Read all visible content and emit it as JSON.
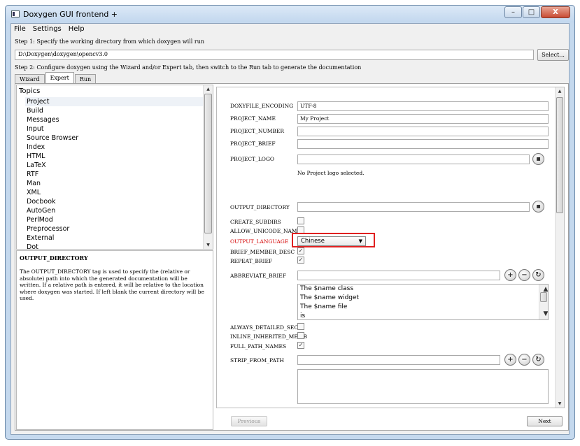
{
  "window": {
    "title": "Doxygen GUI frontend +",
    "min": "–",
    "max": "□",
    "close": "X"
  },
  "menu": [
    "File",
    "Settings",
    "Help"
  ],
  "step1": {
    "label": "Step 1: Specify the working directory from which doxygen will run",
    "directory": "D:\\Doxygen\\doxygen\\opencv3.0",
    "select_label": "Select..."
  },
  "step2": {
    "label": "Step 2: Configure doxygen using the Wizard and/or Expert tab, then switch to the Run tab to generate the documentation"
  },
  "tabs": [
    "Wizard",
    "Expert",
    "Run"
  ],
  "topics": {
    "heading": "Topics",
    "items": [
      "Project",
      "Build",
      "Messages",
      "Input",
      "Source Browser",
      "Index",
      "HTML",
      "LaTeX",
      "RTF",
      "Man",
      "XML",
      "Docbook",
      "AutoGen",
      "PerlMod",
      "Preprocessor",
      "External",
      "Dot"
    ],
    "selected": "Project"
  },
  "help": {
    "title": "OUTPUT_DIRECTORY",
    "text": "The OUTPUT_DIRECTORY tag is used to specify the (relative or absolute) path into which the generated documentation will be written. If a relative path is entered, it will be relative to the location where doxygen was started. If left blank the current directory will be used."
  },
  "settings": {
    "doxyfile_encoding": {
      "label": "DOXYFILE_ENCODING",
      "value": "UTF-8"
    },
    "project_name": {
      "label": "PROJECT_NAME",
      "value": "My Project"
    },
    "project_number": {
      "label": "PROJECT_NUMBER",
      "value": ""
    },
    "project_brief": {
      "label": "PROJECT_BRIEF",
      "value": ""
    },
    "project_logo": {
      "label": "PROJECT_LOGO",
      "value": "",
      "note": "No Project logo selected."
    },
    "output_directory": {
      "label": "OUTPUT_DIRECTORY",
      "value": ""
    },
    "create_subdirs": {
      "label": "CREATE_SUBDIRS",
      "checked": false
    },
    "allow_unicode_names": {
      "label": "ALLOW_UNICODE_NAMES",
      "checked": false
    },
    "output_language": {
      "label": "OUTPUT_LANGUAGE",
      "value": "Chinese"
    },
    "brief_member_desc": {
      "label": "BRIEF_MEMBER_DESC",
      "checked": true
    },
    "repeat_brief": {
      "label": "REPEAT_BRIEF",
      "checked": true
    },
    "abbreviate_brief": {
      "label": "ABBREVIATE_BRIEF",
      "value": "",
      "items": [
        "The $name class",
        "The $name widget",
        "The $name file",
        "is"
      ]
    },
    "always_detailed_sec": {
      "label": "ALWAYS_DETAILED_SEC",
      "checked": false
    },
    "inline_inherited_memb": {
      "label": "INLINE_INHERITED_MEMB",
      "checked": false
    },
    "full_path_names": {
      "label": "FULL_PATH_NAMES",
      "checked": true
    },
    "strip_from_path": {
      "label": "STRIP_FROM_PATH",
      "value": ""
    },
    "check_mark": "✓",
    "plus": "+",
    "minus": "−",
    "reset": "↻",
    "browse": "▪"
  },
  "nav": {
    "previous": "Previous",
    "next": "Next"
  },
  "accent": {
    "highlight_box": "#e02020",
    "error_label": "#d40000"
  }
}
